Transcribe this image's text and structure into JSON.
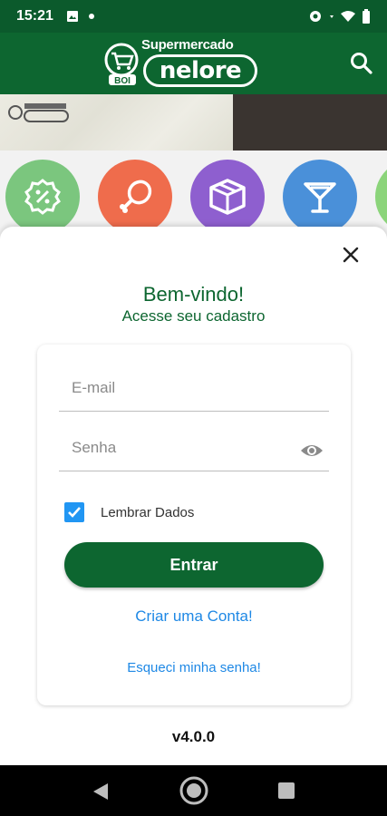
{
  "status_bar": {
    "time": "15:21",
    "icons": [
      "image-icon",
      "dot-icon",
      "vpn-key-icon",
      "wifi-icon",
      "battery-icon"
    ]
  },
  "app_bar": {
    "logo_top": "Supermercado",
    "logo_main": "nelore",
    "logo_badge": "BOI",
    "search_icon": "search-icon"
  },
  "categories": [
    {
      "icon": "discount-badge-icon",
      "color": "#7bc67e"
    },
    {
      "icon": "chicken-leg-icon",
      "color": "#ef6c4c"
    },
    {
      "icon": "box-icon",
      "color": "#8e5fcf"
    },
    {
      "icon": "cocktail-glass-icon",
      "color": "#4a90d9"
    },
    {
      "icon": "partial-category-icon",
      "color": "#8bd47a"
    }
  ],
  "login": {
    "title": "Bem-vindo!",
    "subtitle": "Acesse seu cadastro",
    "email_placeholder": "E-mail",
    "password_placeholder": "Senha",
    "remember_label": "Lembrar Dados",
    "remember_checked": true,
    "submit_label": "Entrar",
    "create_account_label": "Criar uma Conta!",
    "forgot_password_label": "Esqueci minha senha!"
  },
  "version": "v4.0.0",
  "colors": {
    "primary": "#0d6630",
    "status_bar": "#0b5a2c",
    "link": "#1e88e5",
    "checkbox": "#2196f3"
  }
}
